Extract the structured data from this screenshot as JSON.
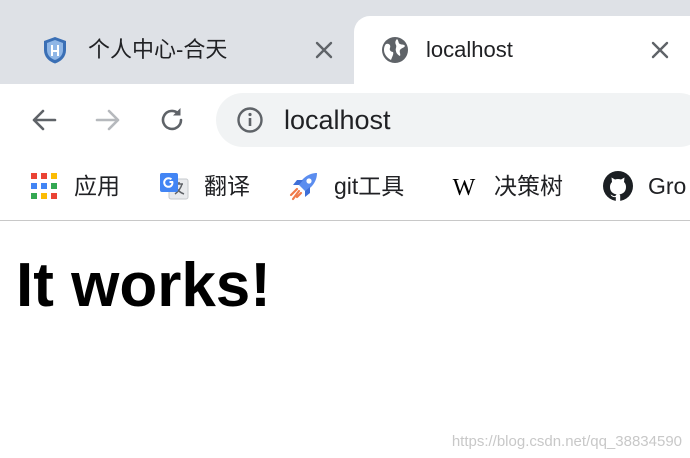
{
  "tabs": [
    {
      "title": "个人中心-合天",
      "icon": "shield-icon",
      "active": false
    },
    {
      "title": "localhost",
      "icon": "globe-icon",
      "active": true
    }
  ],
  "toolbar": {
    "back_icon": "arrow-left-icon",
    "forward_icon": "arrow-right-icon",
    "reload_icon": "reload-icon",
    "url": "localhost",
    "info_icon": "info-icon"
  },
  "bookmarks": [
    {
      "label": "应用",
      "icon": "apps-grid-icon"
    },
    {
      "label": "翻译",
      "icon": "google-translate-icon"
    },
    {
      "label": "git工具",
      "icon": "rocket-icon"
    },
    {
      "label": "决策树",
      "icon": "wikipedia-icon"
    },
    {
      "label": "Gro",
      "icon": "github-icon"
    }
  ],
  "page": {
    "heading": "It works!"
  },
  "watermark": "https://blog.csdn.net/qq_38834590",
  "colors": {
    "tabstrip_bg": "#dee1e6",
    "omnibox_bg": "#f1f3f4",
    "text": "#202124",
    "icon_gray": "#5f6368"
  }
}
